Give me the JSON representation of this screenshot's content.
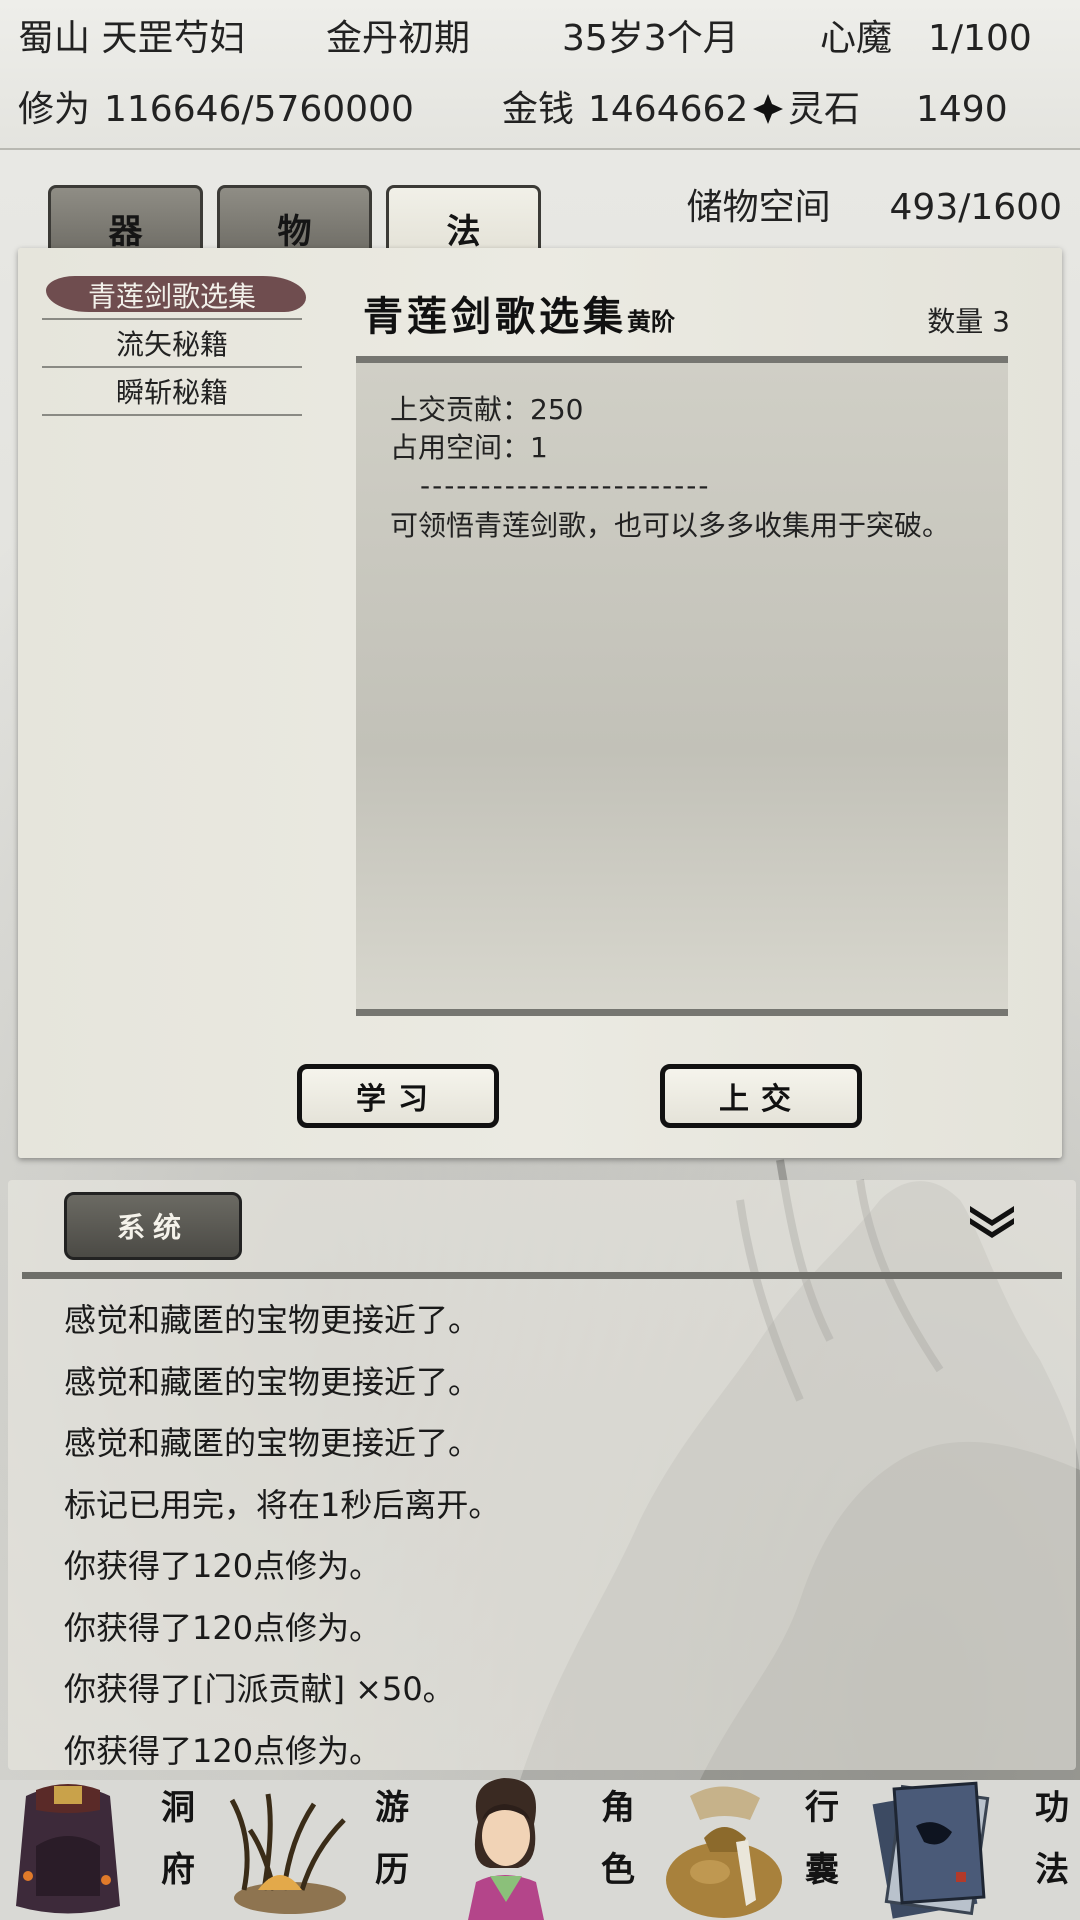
{
  "header": {
    "location": "蜀山 天罡芍妇",
    "realm": "金丹初期",
    "age": "35岁3个月",
    "heart_demon_label": "心魔",
    "heart_demon_value": "1/100",
    "cultivation_label": "修为",
    "cultivation_value": "116646/5760000",
    "money_label": "金钱",
    "money_value": "1464662",
    "spirit_stone_label": "灵石",
    "spirit_stone_value": "1490"
  },
  "tabs": [
    {
      "label": "器",
      "active": false
    },
    {
      "label": "物",
      "active": false
    },
    {
      "label": "法",
      "active": true
    }
  ],
  "storage": {
    "label": "储物空间",
    "value": "493/1600"
  },
  "item_list": [
    {
      "label": "青莲剑歌选集",
      "selected": true
    },
    {
      "label": "流矢秘籍",
      "selected": false
    },
    {
      "label": "瞬斩秘籍",
      "selected": false
    }
  ],
  "detail": {
    "title": "青莲剑歌选集",
    "grade": "黄阶",
    "quantity_label": "数量",
    "quantity_value": "3",
    "contribution_line": "上交贡献：250",
    "space_line": "占用空间：1",
    "divider": "------------------------",
    "description": "可领悟青莲剑歌，也可以多多收集用于突破。"
  },
  "actions": {
    "learn": "学习",
    "submit": "上交"
  },
  "log": {
    "channel_button": "系统",
    "lines": [
      "感觉和藏匿的宝物更接近了。",
      "感觉和藏匿的宝物更接近了。",
      "感觉和藏匿的宝物更接近了。",
      "标记已用完，将在1秒后离开。",
      "你获得了120点修为。",
      "你获得了120点修为。",
      "你获得了[门派贡献] ×50。",
      "你获得了120点修为。"
    ]
  },
  "bottom_nav": [
    {
      "label_top": "洞",
      "label_bottom": "府",
      "icon": "cave-dwelling-icon"
    },
    {
      "label_top": "游",
      "label_bottom": "历",
      "icon": "travel-grass-icon"
    },
    {
      "label_top": "角",
      "label_bottom": "色",
      "icon": "character-portrait-icon"
    },
    {
      "label_top": "行",
      "label_bottom": "囊",
      "icon": "bag-icon"
    },
    {
      "label_top": "功",
      "label_bottom": "法",
      "icon": "scroll-book-icon"
    }
  ],
  "colors": {
    "selected_item_bg": "#6f4d4f",
    "tab_inactive": "#7d7b74",
    "tab_active": "#ebe9df",
    "panel_bg": "#e8e7de"
  }
}
